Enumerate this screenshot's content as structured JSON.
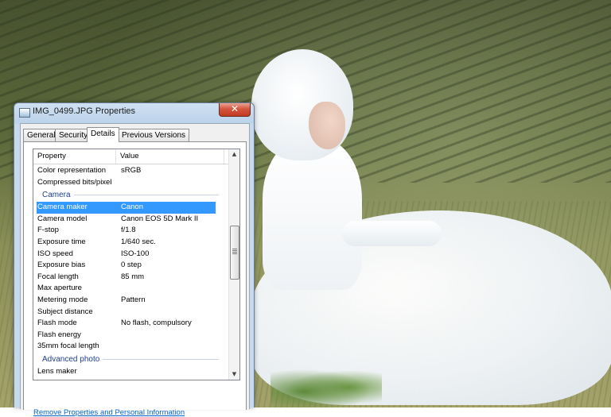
{
  "window": {
    "title": "IMG_0499.JPG Properties",
    "close_glyph": "✕"
  },
  "tabs": [
    {
      "label": "General",
      "active": false
    },
    {
      "label": "Security",
      "active": false
    },
    {
      "label": "Details",
      "active": true
    },
    {
      "label": "Previous Versions",
      "active": false
    }
  ],
  "details": {
    "columns": {
      "property": "Property",
      "value": "Value"
    },
    "rows": [
      {
        "property": "Color representation",
        "value": "sRGB"
      },
      {
        "property": "Compressed bits/pixel",
        "value": ""
      }
    ],
    "camera_group": "Camera",
    "camera_rows": [
      {
        "property": "Camera maker",
        "value": "Canon",
        "selected": true
      },
      {
        "property": "Camera model",
        "value": "Canon EOS 5D Mark II"
      },
      {
        "property": "F-stop",
        "value": "f/1.8"
      },
      {
        "property": "Exposure time",
        "value": "1/640 sec."
      },
      {
        "property": "ISO speed",
        "value": "ISO-100"
      },
      {
        "property": "Exposure bias",
        "value": "0 step"
      },
      {
        "property": "Focal length",
        "value": "85 mm"
      },
      {
        "property": "Max aperture",
        "value": ""
      },
      {
        "property": "Metering mode",
        "value": "Pattern"
      },
      {
        "property": "Subject distance",
        "value": ""
      },
      {
        "property": "Flash mode",
        "value": "No flash, compulsory"
      },
      {
        "property": "Flash energy",
        "value": ""
      },
      {
        "property": "35mm focal length",
        "value": ""
      }
    ],
    "advanced_group": "Advanced photo",
    "advanced_rows": [
      {
        "property": "Lens maker",
        "value": ""
      }
    ]
  },
  "scrollbar": {
    "up_icon": "▲",
    "down_icon": "▼"
  },
  "remove_link": "Remove Properties and Personal Information",
  "colors": {
    "selection": "#3399ff",
    "link": "#0066cc",
    "group_header": "#1e3f8e"
  }
}
